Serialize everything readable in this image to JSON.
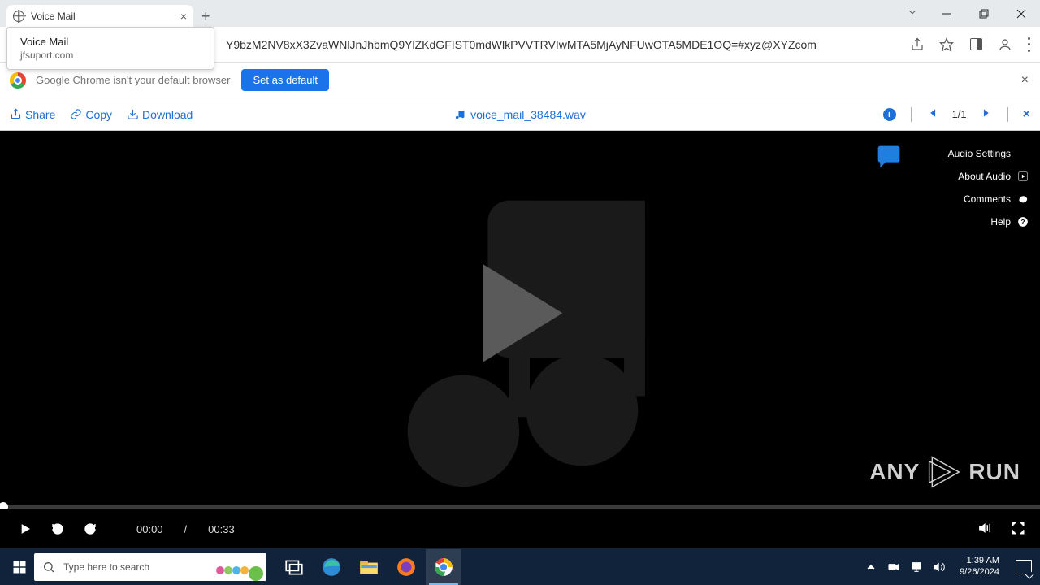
{
  "tab": {
    "title": "Voice Mail"
  },
  "tooltip": {
    "title": "Voice Mail",
    "subtitle": "jfsuport.com"
  },
  "address": {
    "url_fragment": "Y9bzM2NV8xX3ZvaWNlJnJhbmQ9YlZKdGFIST0mdWlkPVVTRVIwMTA5MjAyNFUwOTA5MDE1OQ=#xyz@XYZcom"
  },
  "banner": {
    "text": "Google Chrome isn't your default browser",
    "button": "Set as default"
  },
  "player_toolbar": {
    "share": "Share",
    "copy": "Copy",
    "download": "Download",
    "filename": "voice_mail_38484.wav",
    "page_indicator": "1/1"
  },
  "side_menu": {
    "audio_settings": "Audio Settings",
    "about_audio": "About Audio",
    "comments": "Comments",
    "help": "Help"
  },
  "controls": {
    "current_time": "00:00",
    "separator": "/",
    "total_time": "00:33"
  },
  "watermark": {
    "text_a": "ANY",
    "text_b": "RUN"
  },
  "taskbar": {
    "search_placeholder": "Type here to search",
    "clock_time": "1:39 AM",
    "clock_date": "9/26/2024"
  }
}
